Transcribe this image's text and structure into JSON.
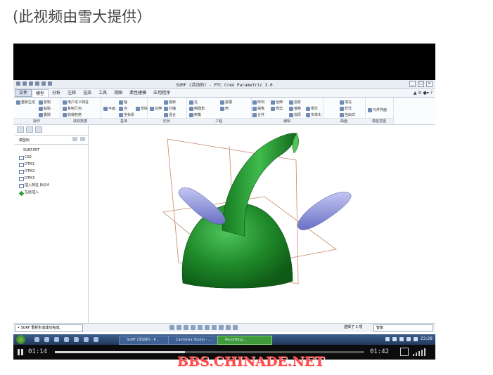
{
  "caption": "(此视频由雪大提供）",
  "watermark": "BBS.CHINADE.NET",
  "app": {
    "title": "SURF (活动的) - PTC Creo Parametric 3.0",
    "menu_tabs": [
      "文件",
      "模型",
      "分析",
      "注释",
      "渲染",
      "工具",
      "视图",
      "柔性建模",
      "应用程序"
    ],
    "active_tab": "模型",
    "ribbon_groups": [
      {
        "label": "操作",
        "commands": [
          "重新生成",
          "复制",
          "粘贴",
          "删除"
        ]
      },
      {
        "label": "获取数据",
        "commands": [
          "用户定义特征",
          "复制几何",
          "收缩包络"
        ]
      },
      {
        "label": "基准",
        "commands": [
          "平面",
          "轴",
          "点",
          "坐标系",
          "草绘"
        ]
      },
      {
        "label": "形状",
        "commands": [
          "拉伸",
          "旋转",
          "扫描",
          "混合"
        ]
      },
      {
        "label": "工程",
        "commands": [
          "孔",
          "倒圆角",
          "倒角",
          "拔模",
          "壳"
        ]
      },
      {
        "label": "编辑",
        "commands": [
          "阵列",
          "镜像",
          "合并",
          "延伸",
          "修剪",
          "投影",
          "偏移",
          "加厚",
          "相交",
          "实体化"
        ]
      },
      {
        "label": "曲面",
        "commands": [
          "填充",
          "样式",
          "自由式"
        ]
      },
      {
        "label": "模型意图",
        "commands": [
          "元件界面"
        ]
      }
    ],
    "tree": {
      "header": "模型树",
      "items": [
        "SURF.PRT",
        "CS0",
        "DTM1",
        "DTM2",
        "DTM3",
        "插入特征 标识4",
        "在此插入"
      ]
    },
    "status_message": "• SURF 重新生成成功完成。",
    "selection_text": "选择了 1 项",
    "filter_value": "智能"
  },
  "taskbar": {
    "tasks": [
      "SURF (活动的) - P...",
      "Camtasia Studio - ...",
      "Recording..."
    ],
    "clock": "23:28"
  },
  "video": {
    "current_time": "01:14",
    "duration": "01:42",
    "progress": 0.42
  },
  "colors": {
    "model_green": "#1f8a2a",
    "horn_blue": "#8d93dd",
    "datum_plane": "#c7876b",
    "watermark": "#ff4a4a"
  }
}
